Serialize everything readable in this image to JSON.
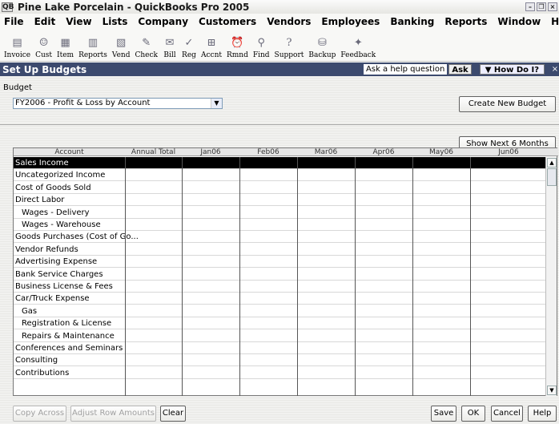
{
  "window": {
    "title": "Pine Lake Porcelain - QuickBooks Pro 2005"
  },
  "menu": [
    "File",
    "Edit",
    "View",
    "Lists",
    "Company",
    "Customers",
    "Vendors",
    "Employees",
    "Banking",
    "Reports",
    "Window",
    "Help"
  ],
  "toolbar": [
    {
      "label": "Invoice",
      "icon": "invoice-icon"
    },
    {
      "label": "Cust",
      "icon": "customer-icon"
    },
    {
      "label": "Item",
      "icon": "item-icon"
    },
    {
      "label": "Reports",
      "icon": "reports-icon"
    },
    {
      "label": "Vend",
      "icon": "vendor-icon"
    },
    {
      "label": "Check",
      "icon": "check-icon"
    },
    {
      "label": "Bill",
      "icon": "bill-icon"
    },
    {
      "label": "Reg",
      "icon": "register-icon"
    },
    {
      "label": "Accnt",
      "icon": "account-icon"
    },
    {
      "label": "Rmnd",
      "icon": "reminder-icon"
    },
    {
      "label": "Find",
      "icon": "find-icon"
    },
    {
      "label": "Support",
      "icon": "support-icon"
    },
    {
      "label": "Backup",
      "icon": "backup-icon"
    },
    {
      "label": "Feedback",
      "icon": "feedback-icon"
    }
  ],
  "panel": {
    "title": "Set Up Budgets",
    "help_question": "Ask a help question",
    "ask": "Ask",
    "how_do_i": "How Do I?"
  },
  "budget": {
    "label": "Budget",
    "selected": "FY2006 - Profit & Loss by Account",
    "create_button": "Create New Budget",
    "show_next": "Show Next 6 Months >>"
  },
  "grid": {
    "columns": [
      "Account",
      "Annual Total",
      "Jan06",
      "Feb06",
      "Mar06",
      "Apr06",
      "May06",
      "Jun06"
    ],
    "rows": [
      {
        "name": "Sales Income",
        "indent": false,
        "selected": true
      },
      {
        "name": "Uncategorized Income",
        "indent": false
      },
      {
        "name": "Cost of Goods Sold",
        "indent": false
      },
      {
        "name": "Direct Labor",
        "indent": false
      },
      {
        "name": "Wages - Delivery",
        "indent": true
      },
      {
        "name": "Wages - Warehouse",
        "indent": true
      },
      {
        "name": "Goods Purchases (Cost of Go...",
        "indent": false
      },
      {
        "name": "Vendor Refunds",
        "indent": false
      },
      {
        "name": "Advertising Expense",
        "indent": false
      },
      {
        "name": "Bank Service Charges",
        "indent": false
      },
      {
        "name": "Business License & Fees",
        "indent": false
      },
      {
        "name": "Car/Truck Expense",
        "indent": false
      },
      {
        "name": "Gas",
        "indent": true
      },
      {
        "name": "Registration & License",
        "indent": true
      },
      {
        "name": "Repairs & Maintenance",
        "indent": true
      },
      {
        "name": "Conferences and Seminars",
        "indent": false
      },
      {
        "name": "Consulting",
        "indent": false
      },
      {
        "name": "Contributions",
        "indent": false
      }
    ]
  },
  "footer": {
    "copy_across": "Copy Across",
    "adjust_row": "Adjust Row Amounts",
    "clear": "Clear",
    "save": "Save",
    "ok": "OK",
    "cancel": "Cancel",
    "help": "Help"
  }
}
